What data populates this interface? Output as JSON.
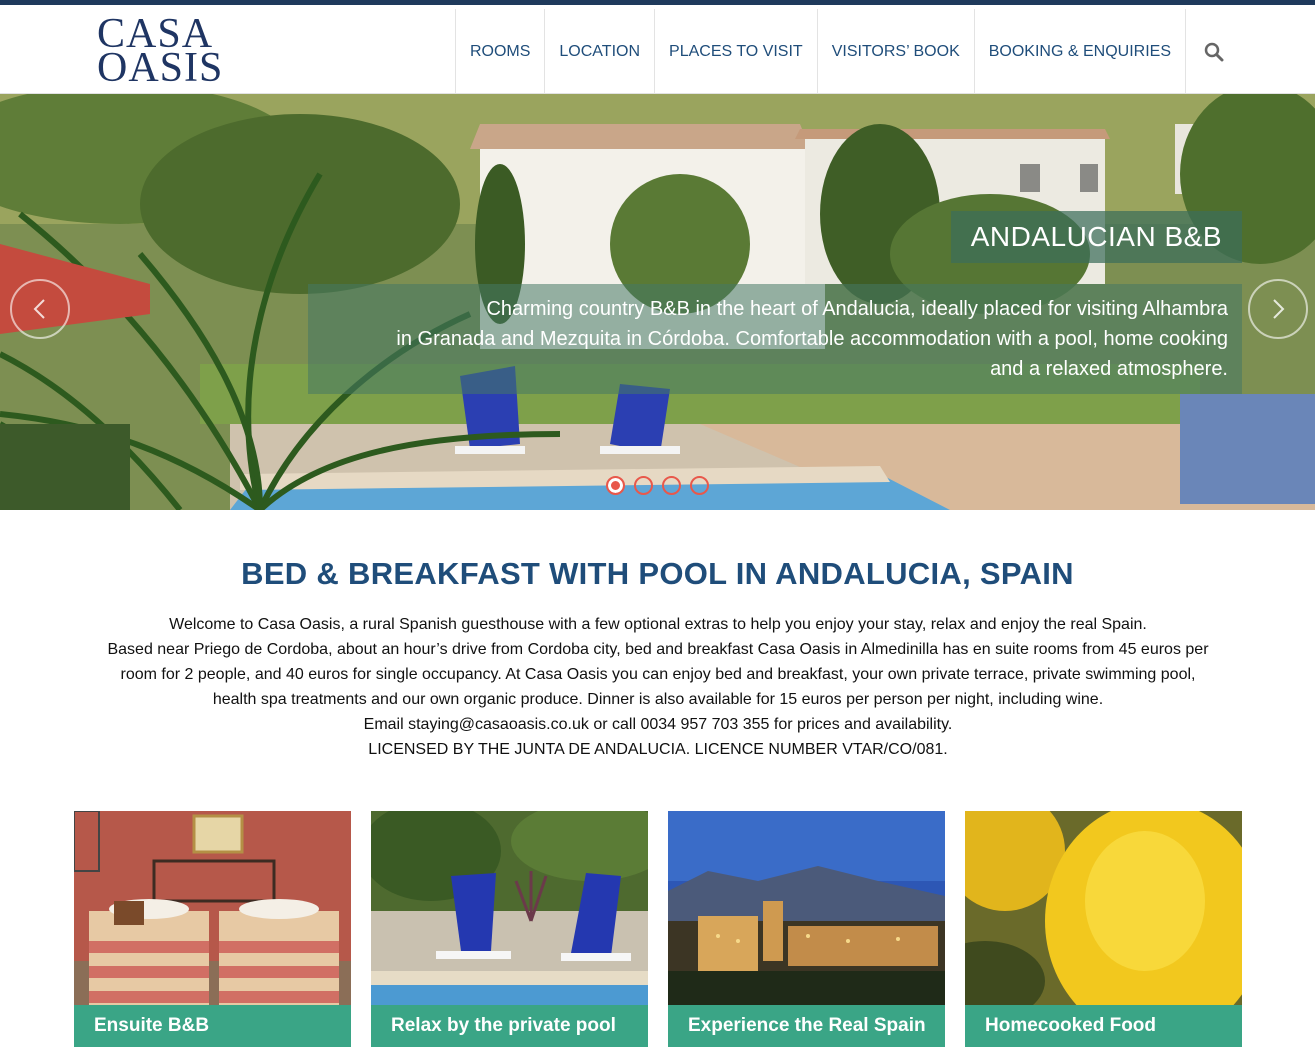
{
  "brand": {
    "logo_line1": "CASA",
    "logo_line2": "OASIS"
  },
  "nav": {
    "items": [
      {
        "label": "ROOMS"
      },
      {
        "label": "LOCATION"
      },
      {
        "label": "PLACES TO VISIT"
      },
      {
        "label": "VISITORS’ BOOK"
      },
      {
        "label": "BOOKING & ENQUIRIES"
      }
    ],
    "search_icon": "search-icon"
  },
  "hero": {
    "title": "ANDALUCIAN B&B",
    "lines": [
      "Charming country B&B in the heart of Andalucia, ideally placed for visiting Alhambra",
      "in Granada and Mezquita in Córdoba. Comfortable accommodation with a pool, home cooking",
      "and a relaxed atmosphere."
    ],
    "slides": 4,
    "active_slide": 1
  },
  "intro": {
    "heading": "BED & BREAKFAST WITH POOL IN ANDALUCIA, SPAIN",
    "lines": [
      "Welcome to Casa Oasis, a rural Spanish guesthouse with a few optional extras to help you enjoy your stay, relax and enjoy the real Spain.",
      "Based near Priego de Cordoba, about an hour’s drive from Cordoba city, bed and breakfast Casa Oasis in Almedinilla has en suite rooms from 45 euros per",
      "room for 2 people, and 40 euros for single occupancy. At Casa Oasis you can enjoy bed and breakfast, your own private terrace, private swimming pool,",
      "health spa treatments and our own organic produce. Dinner is also available for 15 euros per person per night, including wine.",
      "Email staying@casaoasis.co.uk or call 0034 957 703 355 for prices and availability.",
      "LICENSED BY THE JUNTA DE ANDALUCIA. LICENCE NUMBER VTAR/CO/081."
    ]
  },
  "cards": [
    {
      "caption": "Ensuite B&B"
    },
    {
      "caption": "Relax by the private pool"
    },
    {
      "caption": "Experience the Real Spain"
    },
    {
      "caption": "Homecooked Food"
    }
  ],
  "colors": {
    "accent": "#3aa586",
    "nav_text": "#1f4d7a",
    "logo": "#1f3563",
    "dot": "#e8584b"
  }
}
